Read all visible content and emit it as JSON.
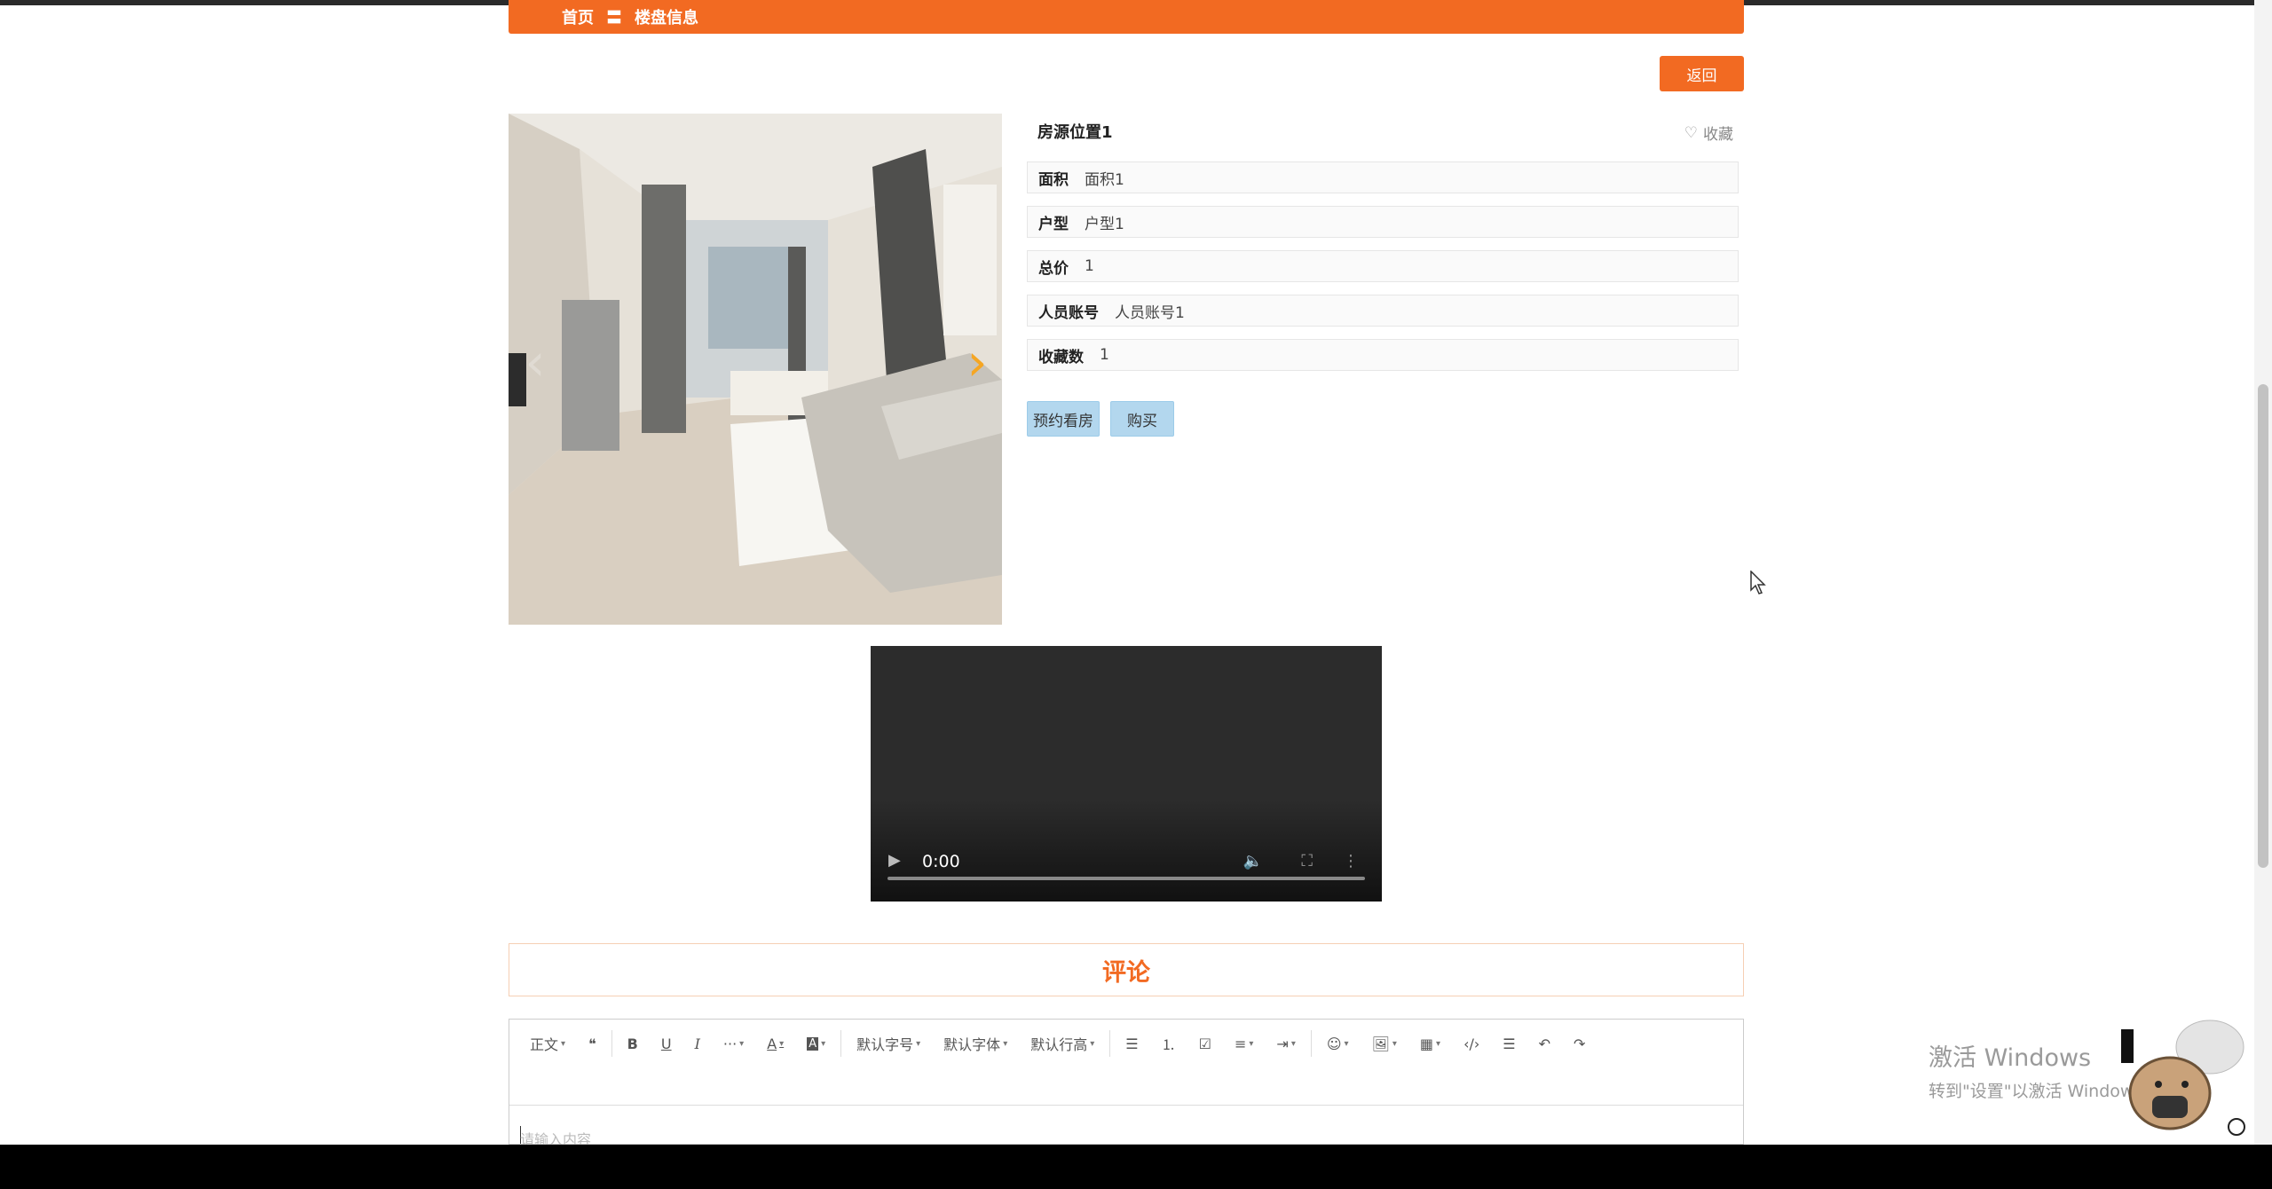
{
  "breadcrumb": {
    "home": "首页",
    "separator": "〓",
    "current": "楼盘信息"
  },
  "back_button": "返回",
  "carousel": {
    "prev_icon": "chevron-left-icon",
    "next_icon": "chevron-right-icon"
  },
  "house": {
    "title": "房源位置1",
    "favorite_label": "收藏",
    "fields": [
      {
        "label": "面积",
        "value": "面积1"
      },
      {
        "label": "户型",
        "value": "户型1"
      },
      {
        "label": "总价",
        "value": "1"
      },
      {
        "label": "人员账号",
        "value": "人员账号1"
      },
      {
        "label": "收藏数",
        "value": "1"
      }
    ],
    "actions": {
      "book": "预约看房",
      "buy": "购买"
    }
  },
  "video": {
    "time": "0:00",
    "progress": 0
  },
  "comments": {
    "title": "评论",
    "toolbar": {
      "paragraph": "正文",
      "font_size": "默认字号",
      "font_family": "默认字体",
      "line_height": "默认行高"
    },
    "placeholder": "请输入内容"
  },
  "watermark": {
    "title": "激活 Windows",
    "subtitle": "转到\"设置\"以激活 Windows。"
  },
  "colors": {
    "accent": "#f26a22",
    "button_blue": "#b3d7ee",
    "video_bg": "#2c2c2c"
  }
}
